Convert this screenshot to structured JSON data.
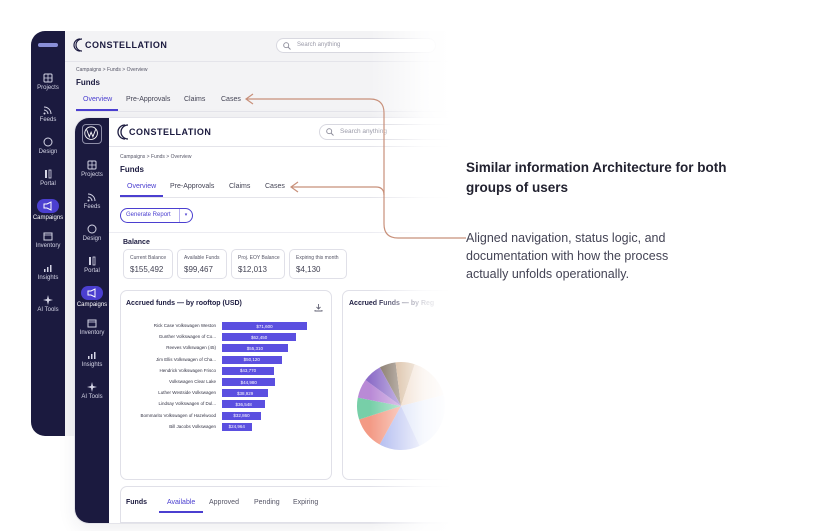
{
  "app": {
    "brand": "CONSTELLATION",
    "search_placeholder": "Search anything"
  },
  "sidebar": {
    "items": [
      {
        "label": "Projects",
        "icon": "grid-icon"
      },
      {
        "label": "Feeds",
        "icon": "rss-icon"
      },
      {
        "label": "Design",
        "icon": "palette-icon"
      },
      {
        "label": "Portal",
        "icon": "portal-icon"
      },
      {
        "label": "Campaigns",
        "icon": "megaphone-icon",
        "active": true
      },
      {
        "label": "Inventory",
        "icon": "calendar-icon"
      },
      {
        "label": "Insights",
        "icon": "bars-icon"
      },
      {
        "label": "AI Tools",
        "icon": "sparkle-icon"
      }
    ]
  },
  "breadcrumb": [
    "Campaigns",
    "Funds",
    "Overview"
  ],
  "page_title": "Funds",
  "tabs": [
    "Overview",
    "Pre-Approvals",
    "Claims",
    "Cases"
  ],
  "generate_report": "Generate Report",
  "balance": {
    "heading": "Balance",
    "stats": [
      {
        "label": "Current Balance",
        "value": "$155,492"
      },
      {
        "label": "Available Funds",
        "value": "$99,467"
      },
      {
        "label": "Proj. EOY Balance",
        "value": "$12,013"
      },
      {
        "label": "Expiring this month",
        "value": "$4,130"
      }
    ]
  },
  "panel_left_title": "Accrued funds — by rooftop (USD)",
  "panel_right_title": "Accrued Funds — by Reg",
  "chart_data": [
    {
      "type": "bar",
      "title": "Accrued funds — by rooftop (USD)",
      "orientation": "horizontal",
      "categories": [
        "Rick Case Volkswagen Weston",
        "Gunther Volkswagen of Co...",
        "Reeves Volkswagen (45)",
        "Jim Ellis Volkswagen of Cha...",
        "Hendrick Volkswagen Frisco",
        "Volkswagen Clear Lake",
        "Luther Westside Volkswagen",
        "Lindsay Volkswagen of Dul...",
        "Bommarito Volkswagen of Hazelwood",
        "Bill Jacobs Volkswagen"
      ],
      "values": [
        71600,
        62450,
        55310,
        50120,
        43770,
        44980,
        38929,
        36548,
        32860,
        24964
      ],
      "value_labels": [
        "$71,600",
        "$62,450",
        "$55,310",
        "$50,120",
        "$43,770",
        "$44,980",
        "$38,929",
        "$36,548",
        "$32,860",
        "$24,964"
      ],
      "color": "#5b4fe0"
    },
    {
      "type": "pie",
      "title": "Accrued Funds — by Reg",
      "slices": [
        {
          "value": 6,
          "color": "#7a6a5a"
        },
        {
          "value": 7,
          "color": "#c9a27a"
        },
        {
          "value": 16,
          "color": "#e8c9b0"
        },
        {
          "value": 22,
          "color": "#c8d4f5"
        },
        {
          "value": 15,
          "color": "#a9b4ee"
        },
        {
          "value": 12,
          "color": "#f39a85"
        },
        {
          "value": 8,
          "color": "#77cfa8"
        },
        {
          "value": 7,
          "color": "#b98ad6"
        },
        {
          "value": 7,
          "color": "#8d6ec8"
        }
      ]
    }
  ],
  "funds_tabs": {
    "heading": "Funds",
    "tabs": [
      "Available",
      "Approved",
      "Pending",
      "Expiring"
    ]
  },
  "callout": {
    "title": "Similar information Architecture for both groups of users",
    "body": "Aligned navigation, status logic, and documentation with how the process actually unfolds operationally."
  },
  "colors": {
    "sidebar": "#1b1a3f",
    "accent": "#4b3fd0",
    "bar": "#5b4fe0",
    "arrow": "#c8907a"
  }
}
